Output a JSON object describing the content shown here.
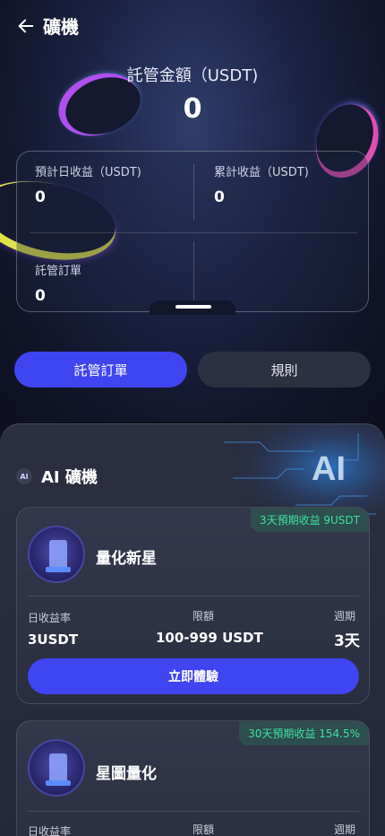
{
  "header": {
    "title": "礦機"
  },
  "summary": {
    "amount_label": "託管金額（USDT)",
    "amount_value": "0",
    "stats": [
      {
        "label": "預計日收益（USDT)",
        "value": "0"
      },
      {
        "label": "累計收益（USDT)",
        "value": "0"
      },
      {
        "label": "託管訂單",
        "value": "0"
      }
    ]
  },
  "actions": {
    "orders_label": "託管訂單",
    "rules_label": "規則"
  },
  "panel": {
    "title": "AI 礦機",
    "badge": "AI"
  },
  "products": [
    {
      "name": "量化新星",
      "tag": "3天預期收益 9USDT",
      "rate_label": "日收益率",
      "rate_value": "3USDT",
      "limit_label": "限額",
      "limit_value": "100-999 USDT",
      "period_label": "週期",
      "period_value": "3天",
      "cta_label": "立即體驗"
    },
    {
      "name": "星圖量化",
      "tag": "30天預期收益 154.5%",
      "rate_label": "日收益率",
      "limit_label": "限額",
      "period_label": "週期"
    }
  ],
  "colors": {
    "accent": "#3f45f0",
    "tag_green": "#3ee0a0"
  }
}
